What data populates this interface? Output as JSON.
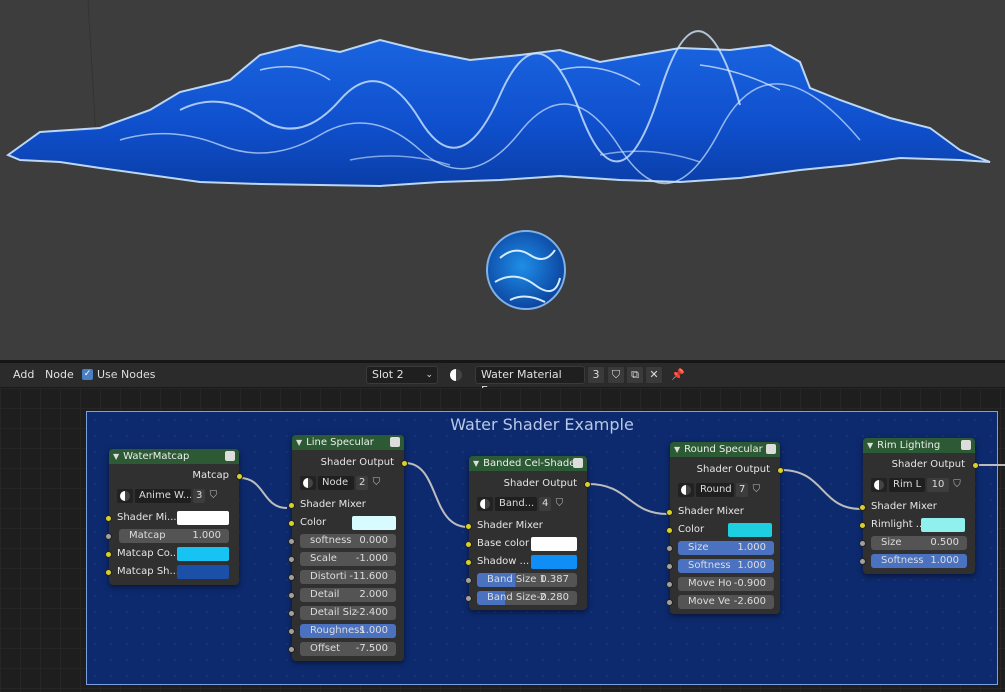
{
  "header": {
    "add_label": "Add",
    "node_label": "Node",
    "use_nodes_label": "Use Nodes",
    "use_nodes_checked": true,
    "slot_label": "Slot 2",
    "material_name": "Water Material Exa...",
    "material_users": "3"
  },
  "frame": {
    "title": "Water Shader Example"
  },
  "nodes": {
    "water_matcap": {
      "title": "WaterMatcap",
      "output": "Matcap",
      "mat_name": "Anime W...",
      "mat_users": "3",
      "inputs": [
        "Shader Mi...",
        "Matcap",
        "Matcap Co...",
        "Matcap Sh..."
      ],
      "matcap_value": "1.000",
      "colors": [
        "#ffffff",
        "#16c3f3",
        "#1c4fa8"
      ]
    },
    "line_specular": {
      "title": "Line Specular",
      "output": "Shader Output",
      "mat_name": "Node",
      "mat_users": "2",
      "shader_mixer": "Shader Mixer",
      "color_label": "Color",
      "color": "#d8fbff",
      "fields": [
        {
          "label": "softness",
          "value": "0.000"
        },
        {
          "label": "Scale",
          "value": "-1.000"
        },
        {
          "label": "Distorti",
          "value": "-11.600"
        },
        {
          "label": "Detail",
          "value": "2.000"
        },
        {
          "label": "Detail Siz",
          "value": "-2.400"
        },
        {
          "label": "Roughness",
          "value": "1.000"
        },
        {
          "label": "Offset",
          "value": "-7.500"
        }
      ]
    },
    "banded_cel": {
      "title": "Banded Cel-Shade",
      "output": "Shader Output",
      "mat_name": "Band...",
      "mat_users": "4",
      "shader_mixer": "Shader Mixer",
      "base_color_label": "Base color",
      "base_color": "#ffffff",
      "shadow_label": "Shadow ...",
      "shadow_color": "#0f8ff5",
      "fields": [
        {
          "label": "Band Size 1",
          "value": "0.387",
          "fill": 0.387
        },
        {
          "label": "Band Size 2",
          "value": "-0.280",
          "fill": 0.28
        }
      ]
    },
    "round_specular": {
      "title": "Round Specular",
      "output": "Shader Output",
      "mat_name": "Round",
      "mat_users": "7",
      "shader_mixer": "Shader Mixer",
      "color_label": "Color",
      "color": "#1dcfe0",
      "fields": [
        {
          "label": "Size",
          "value": "1.000"
        },
        {
          "label": "Softness",
          "value": "1.000"
        },
        {
          "label": "Move Ho",
          "value": "-0.900"
        },
        {
          "label": "Move Ve",
          "value": "-2.600"
        }
      ]
    },
    "rim_lighting": {
      "title": "Rim Lighting",
      "output": "Shader Output",
      "mat_name": "Rim L",
      "mat_users": "10",
      "shader_mixer": "Shader Mixer",
      "rimlight_label": "Rimlight ...",
      "rimlight_color": "#8ff0ee",
      "fields": [
        {
          "label": "Size",
          "value": "0.500"
        },
        {
          "label": "Softness",
          "value": "1.000"
        }
      ]
    }
  },
  "colors": {
    "node_header": "#2c5a34",
    "frame_bg": "#0d2a6e",
    "socket_shader": "#d9d12a",
    "socket_value": "#a1a1a1",
    "field_active": "#4a72c0"
  }
}
